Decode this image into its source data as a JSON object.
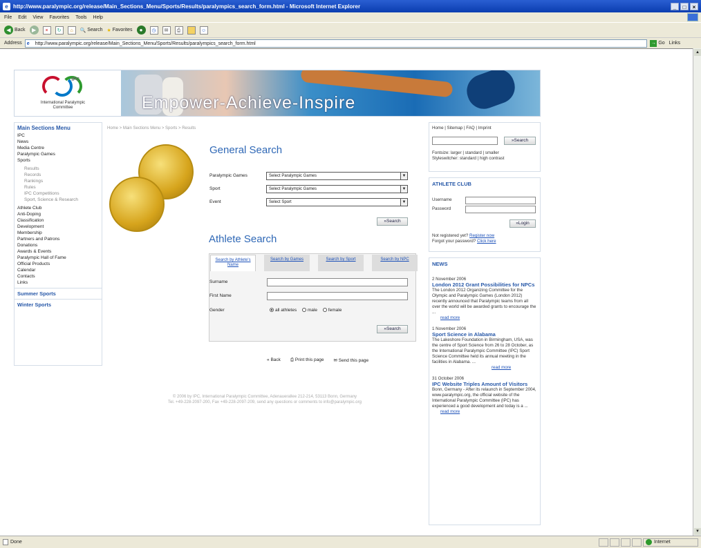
{
  "window": {
    "title": "http://www.paralympic.org/release/Main_Sections_Menu/Sports/Results/paralympics_search_form.html - Microsoft Internet Explorer",
    "controls": [
      "_",
      "□",
      "×"
    ]
  },
  "menubar": [
    "File",
    "Edit",
    "View",
    "Favorites",
    "Tools",
    "Help"
  ],
  "toolbar": {
    "back": "Back",
    "search": "Search",
    "favorites": "Favorites"
  },
  "address": {
    "label": "Address",
    "url": "http://www.paralympic.org/release/Main_Sections_Menu/Sports/Results/paralympics_search_form.html",
    "go": "Go",
    "links": "Links"
  },
  "status": {
    "text": "Done",
    "zone": "Internet"
  },
  "header": {
    "ipc": "IPC",
    "org_line1": "International Paralympic",
    "org_line2": "Committee",
    "slogan": "Empower-Achieve-Inspire"
  },
  "nav": {
    "heading": "Main Sections Menu",
    "items": [
      "IPC",
      "News",
      "Media Centre",
      "Paralympic Games",
      "Sports"
    ],
    "sub": [
      "Results",
      "Records",
      "Rankings",
      "Rules",
      "IPC Competitions",
      "Sport, Science & Research"
    ],
    "items2": [
      "Athlete Club",
      "Anti-Doping",
      "Classification",
      "Development",
      "Membership",
      "Partners and Patrons",
      "Donations",
      "Awards & Events",
      "Paralympic Hall of Fame",
      "Official Products",
      "Calendar",
      "Contacts",
      "Links"
    ],
    "summer": "Summer Sports",
    "winter": "Winter Sports"
  },
  "breadcrumb": "Home > Main Sections Menu > Sports > Results",
  "general": {
    "title": "General Search",
    "label_games": "Paralympic Games",
    "label_sport": "Sport",
    "label_event": "Event",
    "value_games": "Select Paralympic Games",
    "value_sport": "Select Paralympic Games",
    "value_event": "Select Sport",
    "search": "»Search"
  },
  "athlete": {
    "title": "Athlete Search",
    "tabs": [
      "Search by Athlete's Name",
      "Search by Games",
      "Search by Sport",
      "Search by NPC"
    ],
    "label_surname": "Surname",
    "label_first": "First Name",
    "label_gender": "Gender",
    "genders": [
      "all athletes",
      "male",
      "female"
    ],
    "search": "»Search"
  },
  "actions": {
    "back": "Back",
    "print": "Print this page",
    "send": "Send this page"
  },
  "footer": {
    "line1": "© 2006 by IPC, International Paralympic Committee, Adenauerallee 212-214, 53113 Bonn, Germany",
    "line2": "Tel. +49-228-2097-200, Fax +49-228-2097-209, send any questions or comments to info@paralympic.org"
  },
  "right": {
    "links": "Home | Sitemap | FAQ | Imprint",
    "search": "»Search",
    "fontsize": "Fontsize: larger | standard | smaller",
    "style": "Styleswitcher: standard | high contrast",
    "club": {
      "title": "ATHLETE CLUB",
      "user": "Username",
      "pass": "Password",
      "login": "»Login",
      "notreg": "Not registered yet?",
      "register": "Register now",
      "forgot": "Forgot your password?",
      "click": "Click here"
    },
    "news": {
      "title": "NEWS",
      "items": [
        {
          "date": "2 November 2006",
          "headline": "London 2012 Grant Possibilities for NPCs",
          "text": "The London 2012 Organizing Committee for the Olympic and Paralympic Games (London 2012) recently announced that Paralympic teams from all over the world will be awarded grants to encourage the ..."
        },
        {
          "date": "1 November 2006",
          "headline": "Sport Science in Alabama",
          "text": "The Lakeshore Foundation in Birmingham, USA, was the centre of Sport Science from 26 to 28 October, as the International Paralympic Committee (IPC) Sport Science Committee held its annual meeting in the facilities in Alabama. ..."
        },
        {
          "date": "31 October 2006",
          "headline": "IPC Website Triples Amount of Visitors",
          "text": "Bonn, Germany - After its relaunch in September 2004, www.paralympic.org, the official website of the International Paralympic Committee (IPC) has experienced a good development and today is a ..."
        }
      ],
      "more": "read more"
    }
  },
  "colors": {
    "accent": "#2f68b6",
    "nav_heading": "#2758a8",
    "titlebar": "#0b3db0",
    "chrome": "#ece9d8"
  }
}
